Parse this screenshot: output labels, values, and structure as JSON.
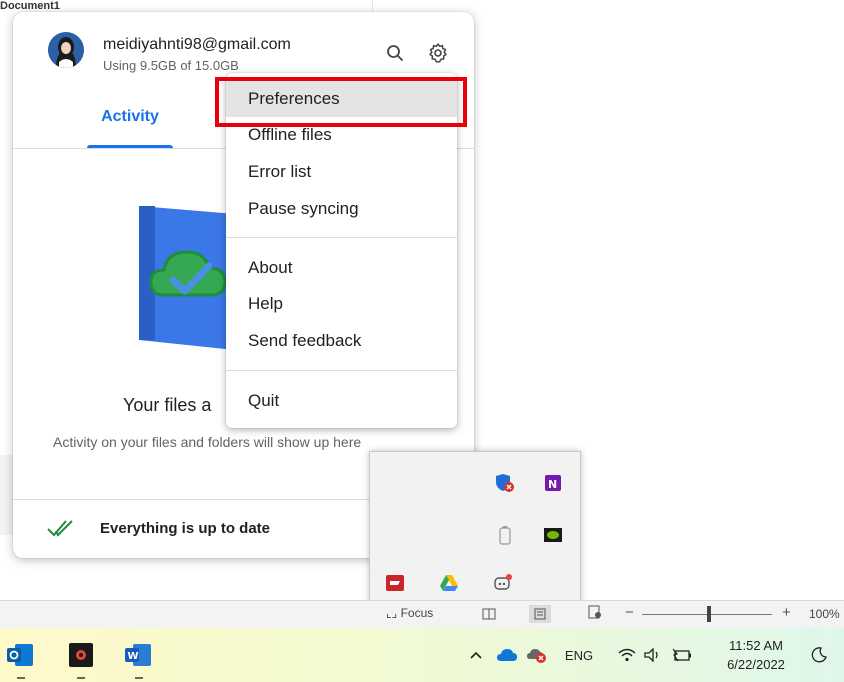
{
  "background": {
    "doc_text": "Document1"
  },
  "drive": {
    "account_email": "meidiyahnti98@gmail.com",
    "storage_text": "Using 9.5GB of 15.0GB",
    "tab_activity": "Activity",
    "empty_title": "Your files a",
    "empty_subtitle": "Activity on your files and folders will show up here",
    "status_text": "Everything is up to date",
    "accent_color": "#1a73e8"
  },
  "menu": {
    "items": [
      {
        "label": "Preferences"
      },
      {
        "label": "Offline files"
      },
      {
        "label": "Error list"
      },
      {
        "label": "Pause syncing"
      },
      {
        "label": "About"
      },
      {
        "label": "Help"
      },
      {
        "label": "Send feedback"
      },
      {
        "label": "Quit"
      }
    ],
    "highlight_color": "#e8000b"
  },
  "statusbar": {
    "focus_label": "Focus",
    "zoom_level": "100%"
  },
  "taskbar": {
    "language": "ENG",
    "time": "11:52 AM",
    "date": "6/22/2022"
  }
}
